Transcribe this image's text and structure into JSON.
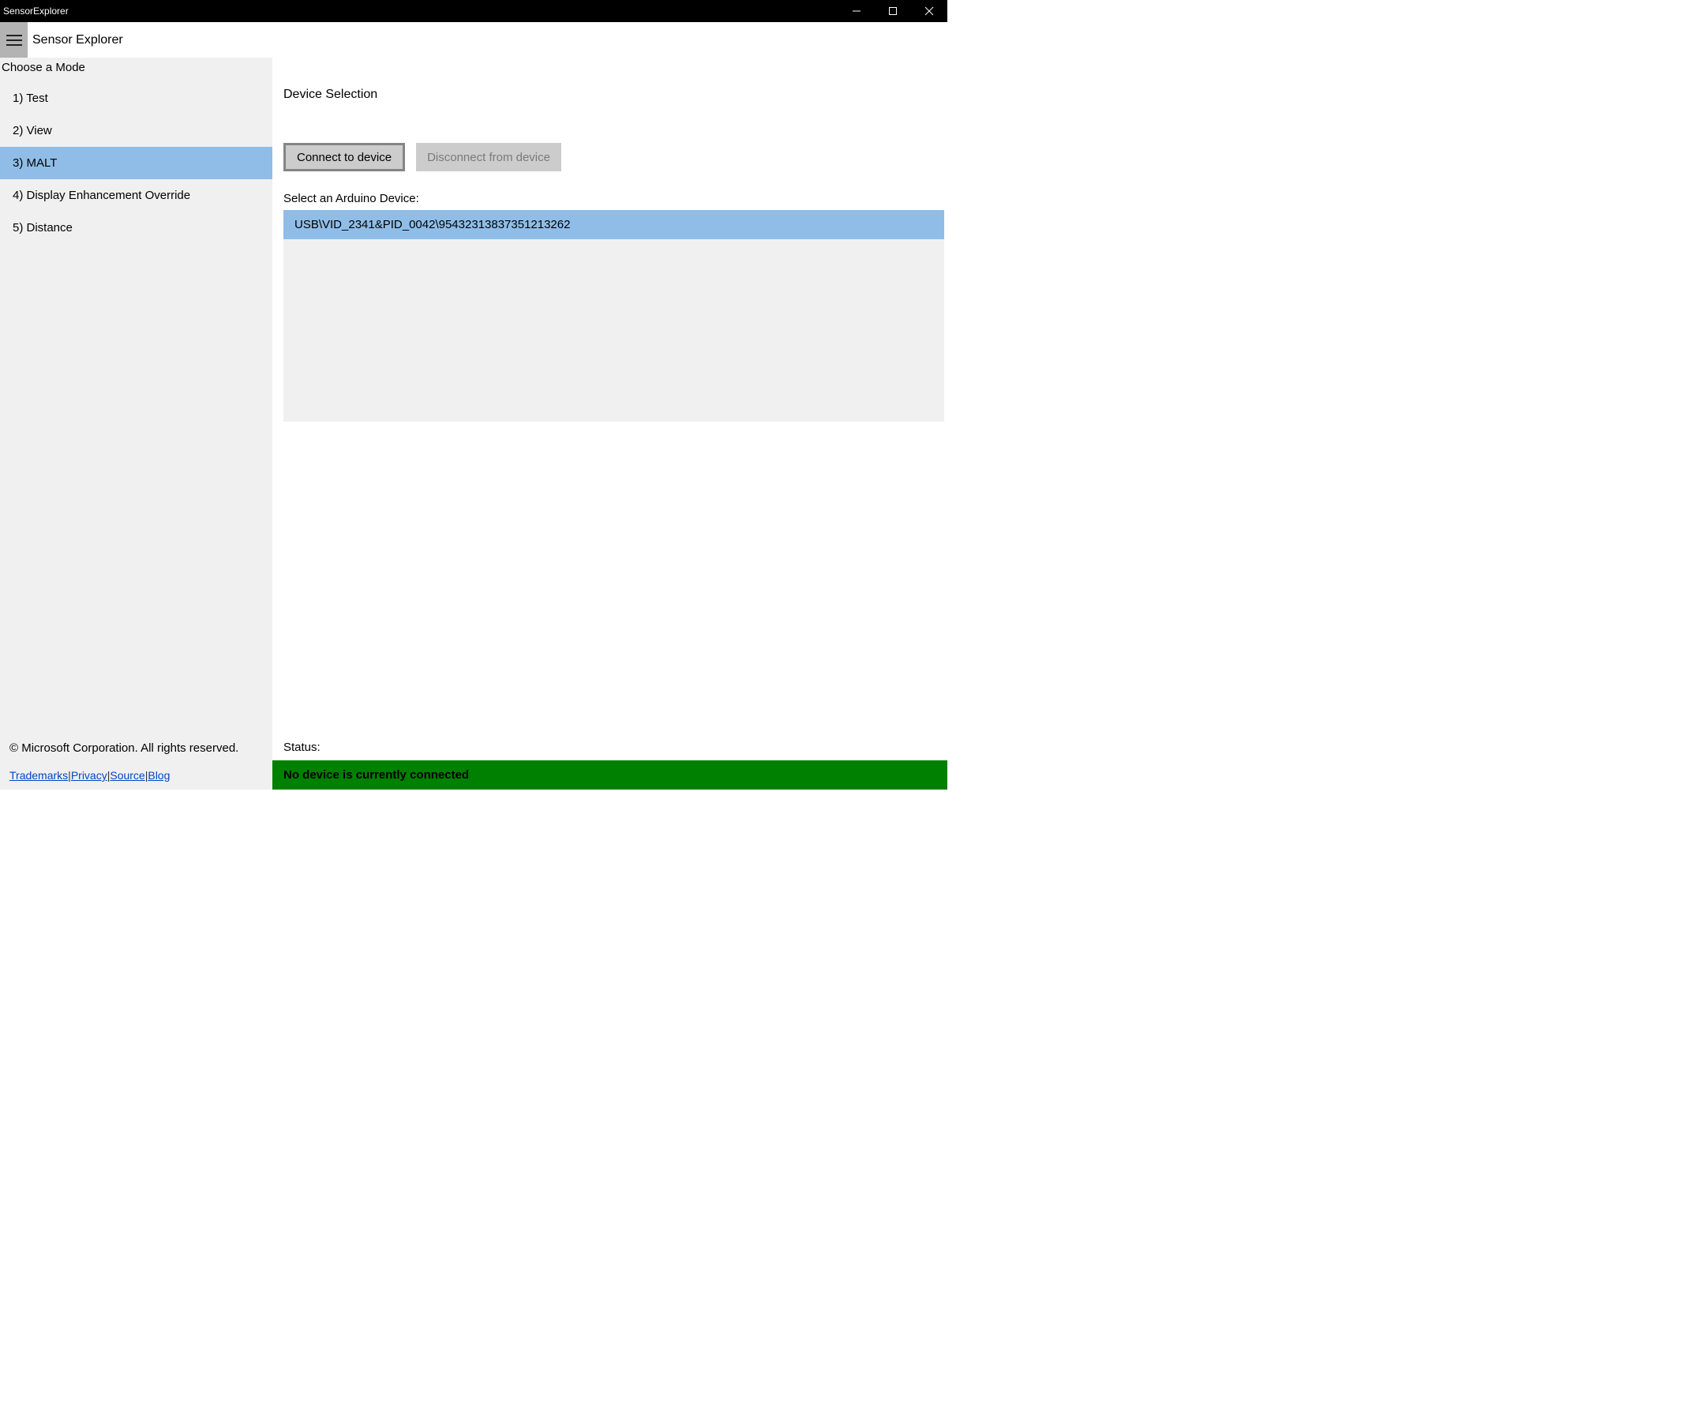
{
  "window": {
    "title": "SensorExplorer"
  },
  "app": {
    "title": "Sensor Explorer"
  },
  "sidebar": {
    "heading": "Choose a Mode",
    "items": [
      {
        "label": "1) Test",
        "selected": false
      },
      {
        "label": "2) View",
        "selected": false
      },
      {
        "label": "3) MALT",
        "selected": true
      },
      {
        "label": "4) Display Enhancement Override",
        "selected": false
      },
      {
        "label": "5) Distance",
        "selected": false
      }
    ],
    "copyright": "© Microsoft Corporation. All rights reserved.",
    "links": {
      "trademarks": "Trademarks",
      "privacy": "Privacy",
      "source": "Source",
      "blog": "Blog"
    }
  },
  "content": {
    "heading": "Device Selection",
    "buttons": {
      "connect": "Connect to device",
      "disconnect": "Disconnect from device"
    },
    "selectLabel": "Select an Arduino Device:",
    "devices": [
      {
        "id": "USB\\VID_2341&PID_0042\\95432313837351213262",
        "selected": true
      }
    ],
    "statusLabel": "Status:",
    "statusMessage": "No device is currently connected",
    "statusColor": "#008000"
  }
}
